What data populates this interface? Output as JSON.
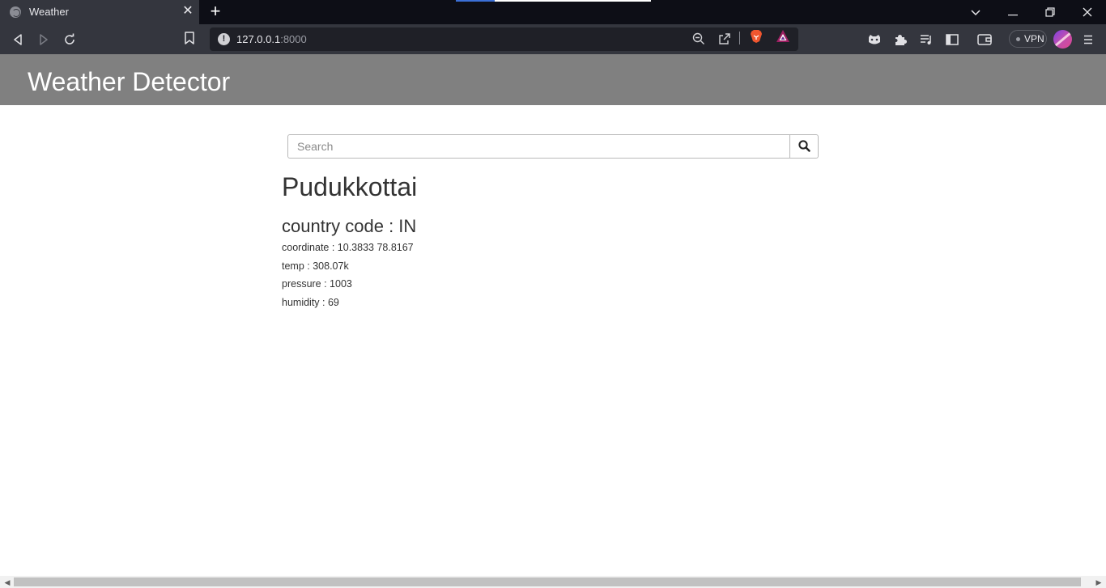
{
  "browser": {
    "tab_title": "Weather",
    "tab_close": "✕",
    "new_tab": "+",
    "url_host": "127.0.0.1",
    "url_port": ":8000",
    "vpn_label": "VPN",
    "window_controls": {
      "tabs_menu": "⌵",
      "minimize": "—",
      "restore": "❐",
      "close": "✕"
    },
    "nav": {
      "back": "◁",
      "forward": "▷",
      "reload": "↻"
    },
    "page_load_progress": 0.2
  },
  "navbar": {
    "brand": "Weather Detector"
  },
  "search": {
    "placeholder": "Search",
    "value": ""
  },
  "weather": {
    "city": "Pudukkottai",
    "country_code": "country code : IN",
    "coordinate": "coordinate : 10.3833 78.8167",
    "temp": "temp : 308.07k",
    "pressure": "pressure : 1003",
    "humidity": "humidity : 69"
  },
  "icons": {
    "search": "search-icon",
    "zoom": "zoom-out-icon",
    "share": "share-icon",
    "brave": "brave-shields-icon",
    "rewards": "brave-rewards-icon",
    "extensions": "puzzle-icon",
    "wallet": "wallet-icon"
  },
  "colors": {
    "navbar": "#808080",
    "brand_text": "#ffffff",
    "body_text": "#333333",
    "chrome_dark": "#0d0e16",
    "chrome_toolbar": "#34363e",
    "omnibox": "#1f2027"
  }
}
